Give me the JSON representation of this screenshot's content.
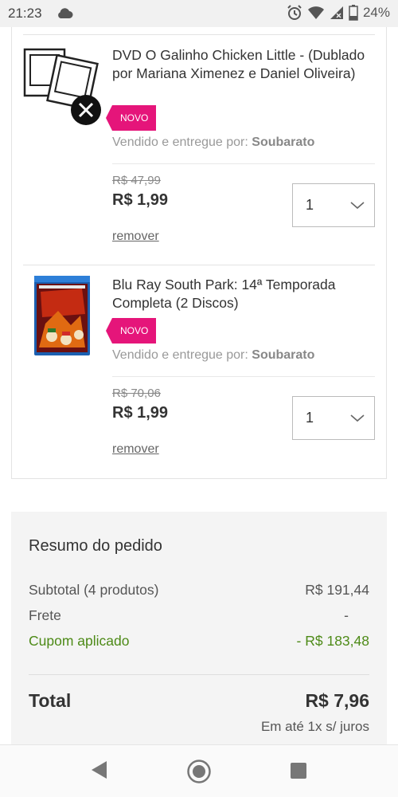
{
  "status_bar": {
    "time": "21:23",
    "battery": "24%",
    "icons": [
      "cloud-icon",
      "alarm-icon",
      "wifi-icon",
      "signal-icon",
      "battery-icon"
    ]
  },
  "cart": {
    "items": [
      {
        "title": "DVD O Galinho Chicken Little - (Dublado por Mariana Ximenez e Daniel Oliveira)",
        "badge": "NOVO",
        "seller_prefix": "Vendido e entregue por:",
        "seller_name": "Soubarato",
        "old_price": "R$ 47,99",
        "price": "R$ 1,99",
        "quantity": "1",
        "remove_label": "remover",
        "image": "placeholder-image-icon"
      },
      {
        "title": "Blu Ray South Park: 14ª Temporada Completa (2 Discos)",
        "badge": "NOVO",
        "seller_prefix": "Vendido e entregue por:",
        "seller_name": "Soubarato",
        "old_price": "R$ 70,06",
        "price": "R$ 1,99",
        "quantity": "1",
        "remove_label": "remover",
        "image": "bluray-cover"
      }
    ]
  },
  "summary": {
    "title": "Resumo do pedido",
    "subtotal_label": "Subtotal (4 produtos)",
    "subtotal_value": "R$ 191,44",
    "shipping_label": "Frete",
    "shipping_value": "-",
    "coupon_label": "Cupom aplicado",
    "coupon_value": "- R$ 183,48",
    "total_label": "Total",
    "total_value": "R$ 7,96",
    "installments": "Em até 1x s/ juros"
  },
  "colors": {
    "badge": "#e5157a",
    "coupon": "#4d8a17"
  },
  "nav": {
    "buttons": [
      "back-icon",
      "home-icon",
      "recents-icon"
    ]
  }
}
